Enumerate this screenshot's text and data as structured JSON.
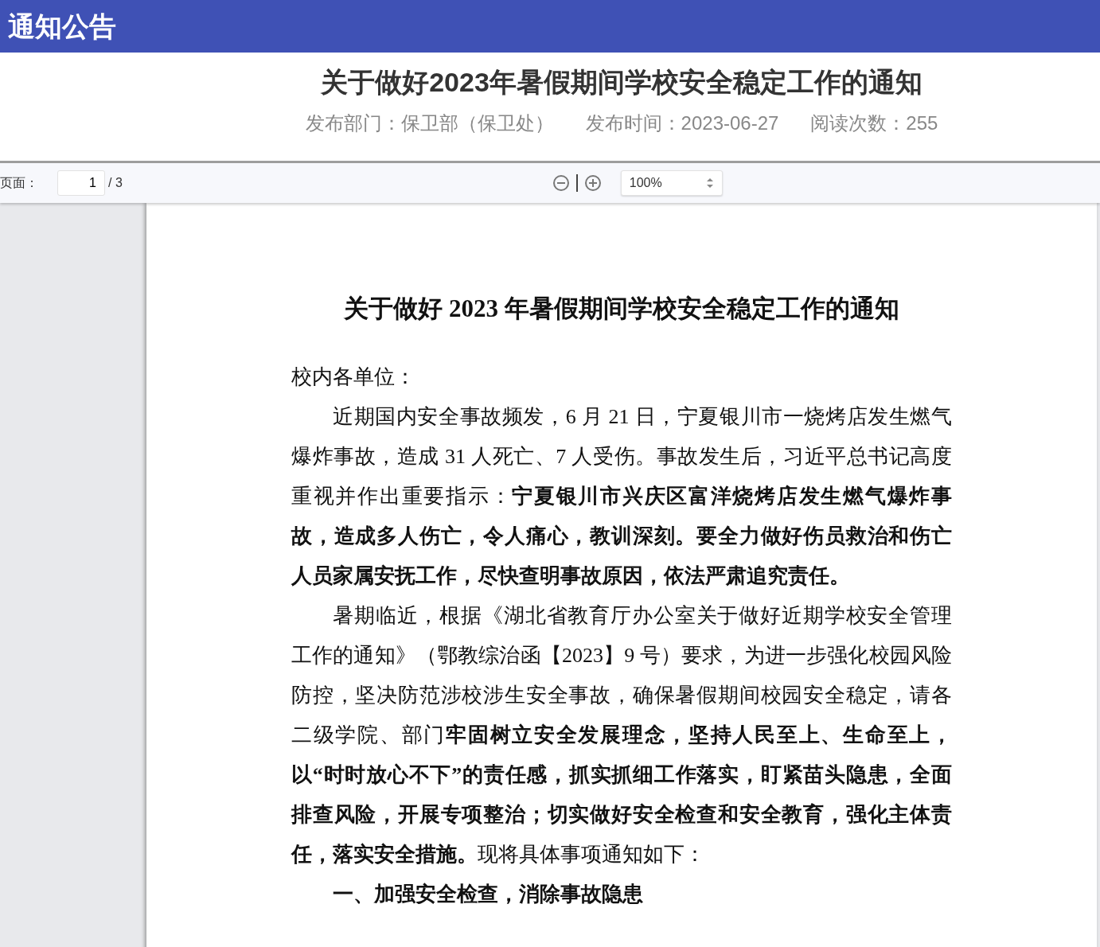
{
  "header": {
    "title": "通知公告"
  },
  "article": {
    "title": "关于做好2023年暑假期间学校安全稳定工作的通知",
    "meta": [
      "发布部门：保卫部（保卫处）",
      "发布时间：2023-06-27",
      "阅读次数：255"
    ]
  },
  "toolbar": {
    "page_label": "页面：",
    "page_input": "1",
    "page_total": "/ 3",
    "zoom_select": "100%"
  },
  "document": {
    "title": "关于做好 2023 年暑假期间学校安全稳定工作的通知",
    "paragraphs": [
      {
        "kind": "salutation",
        "text": "校内各单位："
      },
      {
        "kind": "body",
        "text": "近期国内安全事故频发，6 月 21 日，宁夏银川市一烧烤店发生燃气爆炸事故，造成 31 人死亡、7 人受伤。事故发生后，习近平总书记高度重视并作出重要指示：**宁夏银川市兴庆区富洋烧烤店发生燃气爆炸事故，造成多人伤亡，令人痛心，教训深刻。要全力做好伤员救治和伤亡人员家属安抚工作，尽快查明事故原因，依法严肃追究责任。**"
      },
      {
        "kind": "body",
        "text": "暑期临近，根据《湖北省教育厅办公室关于做好近期学校安全管理工作的通知》（鄂教综治函【2023】9 号）要求，为进一步强化校园风险防控，坚决防范涉校涉生安全事故，确保暑假期间校园安全稳定，请各二级学院、部门**牢固树立安全发展理念，坚持人民至上、生命至上，以“时时放心不下”的责任感，抓实抓细工作落实，盯紧苗头隐患，全面排查风险，开展专项整治；切实做好安全检查和安全教育，强化主体责任，落实安全措施。**现将具体事项通知如下："
      },
      {
        "kind": "heading",
        "text": "一、加强安全检查，消除事故隐患"
      }
    ]
  }
}
